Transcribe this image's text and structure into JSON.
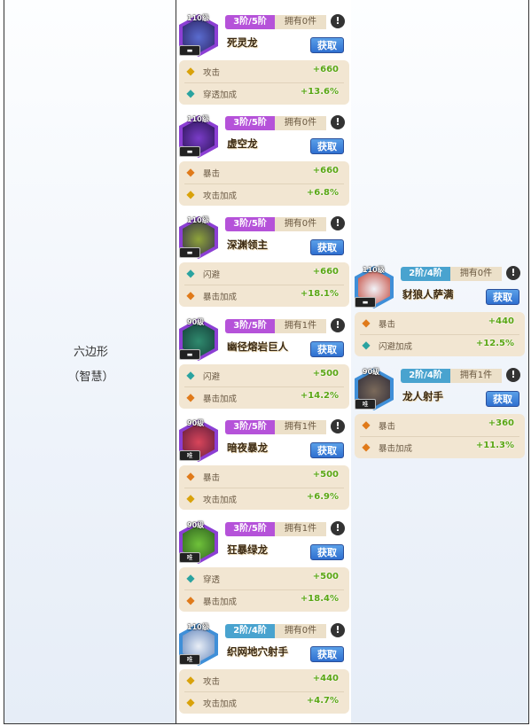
{
  "category": {
    "label": "六边形",
    "sub": "（智慧）"
  },
  "get_label": "获取",
  "col1": [
    {
      "level": "110级",
      "rank": "",
      "tier": "3阶/5阶",
      "owned": "拥有0件",
      "name": "死灵龙",
      "stats": [
        {
          "label": "攻击",
          "value": "+660",
          "icon": "attack-icon"
        },
        {
          "label": "穿透加成",
          "value": "+13.6%",
          "icon": "penetration-icon"
        }
      ]
    },
    {
      "level": "110级",
      "rank": "",
      "tier": "3阶/5阶",
      "owned": "拥有0件",
      "name": "虚空龙",
      "stats": [
        {
          "label": "暴击",
          "value": "+660",
          "icon": "crit-icon"
        },
        {
          "label": "攻击加成",
          "value": "+6.8%",
          "icon": "attack-icon"
        }
      ]
    },
    {
      "level": "110级",
      "rank": "",
      "tier": "3阶/5阶",
      "owned": "拥有0件",
      "name": "深渊领主",
      "stats": [
        {
          "label": "闪避",
          "value": "+660",
          "icon": "dodge-icon"
        },
        {
          "label": "暴击加成",
          "value": "+18.1%",
          "icon": "crit-icon"
        }
      ]
    },
    {
      "level": "90级",
      "rank": "",
      "tier": "3阶/5阶",
      "owned": "拥有1件",
      "name": "幽径熔岩巨人",
      "stats": [
        {
          "label": "闪避",
          "value": "+500",
          "icon": "dodge-icon"
        },
        {
          "label": "暴击加成",
          "value": "+14.2%",
          "icon": "crit-icon"
        }
      ]
    },
    {
      "level": "90级",
      "rank": "唯",
      "tier": "3阶/5阶",
      "owned": "拥有1件",
      "name": "暗夜暴龙",
      "stats": [
        {
          "label": "暴击",
          "value": "+500",
          "icon": "crit-icon"
        },
        {
          "label": "攻击加成",
          "value": "+6.9%",
          "icon": "attack-icon"
        }
      ]
    },
    {
      "level": "90级",
      "rank": "唯",
      "tier": "3阶/5阶",
      "owned": "拥有1件",
      "name": "狂暴绿龙",
      "stats": [
        {
          "label": "穿透",
          "value": "+500",
          "icon": "penetration-icon"
        },
        {
          "label": "暴击加成",
          "value": "+18.4%",
          "icon": "crit-icon"
        }
      ]
    },
    {
      "level": "110级",
      "rank": "唯",
      "tier": "2阶/4阶",
      "owned": "拥有0件",
      "name": "织网地穴射手",
      "stats": [
        {
          "label": "攻击",
          "value": "+440",
          "icon": "attack-icon"
        },
        {
          "label": "攻击加成",
          "value": "+4.7%",
          "icon": "attack-icon"
        }
      ]
    }
  ],
  "col2": [
    {
      "level": "110级",
      "rank": "",
      "tier": "2阶/4阶",
      "owned": "拥有0件",
      "name": "豺狼人萨满",
      "stats": [
        {
          "label": "暴击",
          "value": "+440",
          "icon": "crit-icon"
        },
        {
          "label": "闪避加成",
          "value": "+12.5%",
          "icon": "dodge-icon"
        }
      ]
    },
    {
      "level": "90级",
      "rank": "唯",
      "tier": "2阶/4阶",
      "owned": "拥有1件",
      "name": "龙人射手",
      "stats": [
        {
          "label": "暴击",
          "value": "+360",
          "icon": "crit-icon"
        },
        {
          "label": "暴击加成",
          "value": "+11.3%",
          "icon": "crit-icon"
        }
      ]
    }
  ],
  "colors": {
    "purple_tier": "#b552d9",
    "blue_tier": "#49a3cf",
    "stat_value": "#5aa512",
    "get_button": "#2f6fd0"
  }
}
